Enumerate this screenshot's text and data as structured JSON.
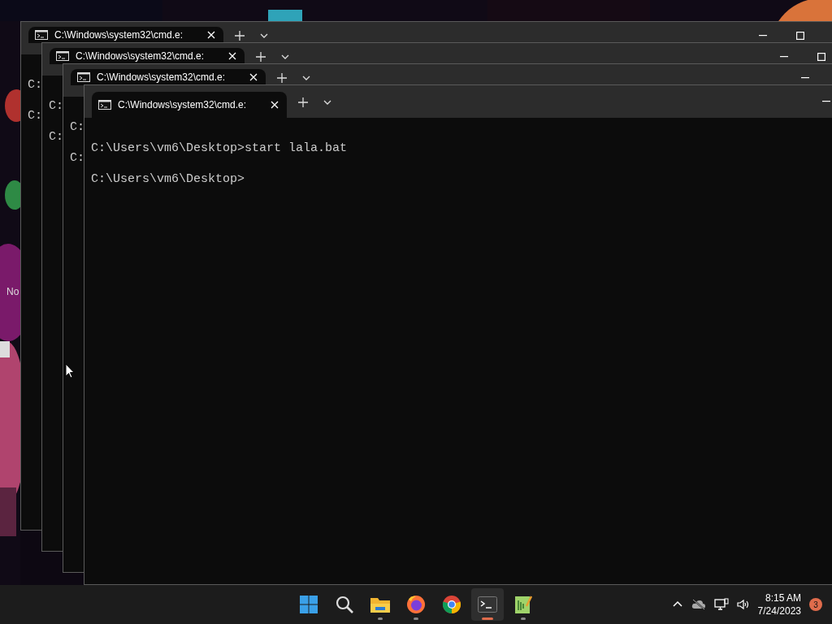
{
  "desktop": {
    "icon_label": "No"
  },
  "windows": [
    {
      "tab_title": "C:\\Windows\\system32\\cmd.e:",
      "lines": [
        "C:",
        "C:"
      ]
    },
    {
      "tab_title": "C:\\Windows\\system32\\cmd.e:",
      "lines": [
        "C:",
        "C:"
      ]
    },
    {
      "tab_title": "C:\\Windows\\system32\\cmd.e:",
      "lines": [
        "C:",
        "C:"
      ]
    },
    {
      "tab_title": "C:\\Windows\\system32\\cmd.e:",
      "lines": [
        "C:\\Users\\vm6\\Desktop>start lala.bat",
        "C:\\Users\\vm6\\Desktop>"
      ]
    }
  ],
  "taskbar": {
    "apps": [
      {
        "kind": "start",
        "running": false,
        "selected": false
      },
      {
        "kind": "search",
        "running": false,
        "selected": false
      },
      {
        "kind": "files",
        "running": true,
        "selected": false
      },
      {
        "kind": "firefox",
        "running": true,
        "selected": false
      },
      {
        "kind": "chrome",
        "running": false,
        "selected": false
      },
      {
        "kind": "terminal",
        "running": true,
        "selected": true
      },
      {
        "kind": "notepad",
        "running": true,
        "selected": false
      }
    ],
    "time": "8:15 AM",
    "date": "7/24/2023",
    "notification_count": "3"
  }
}
